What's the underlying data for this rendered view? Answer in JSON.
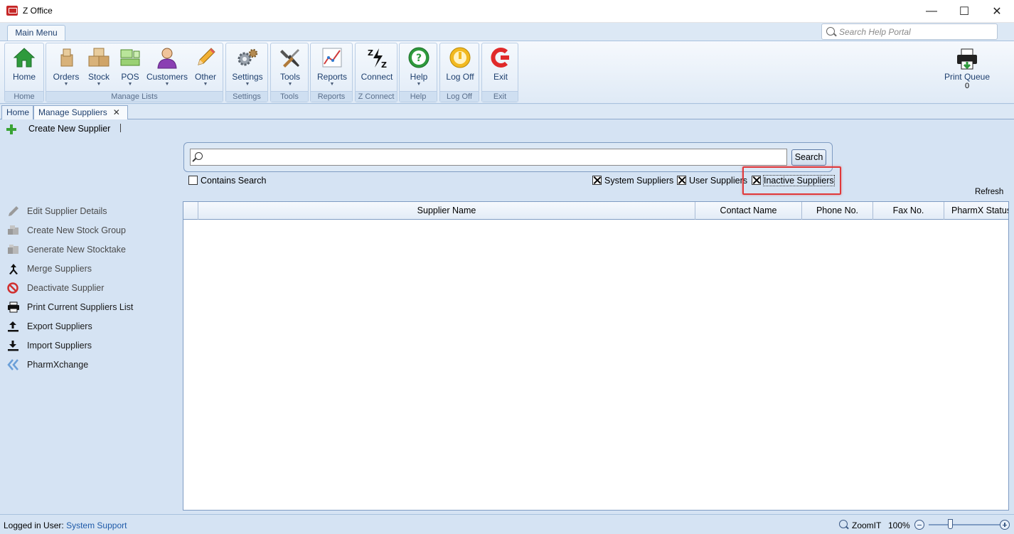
{
  "window": {
    "title": "Z Office",
    "controls": {
      "minimize": "—",
      "maximize": "☐",
      "close": "✕"
    }
  },
  "ribbon": {
    "tab": "Main Menu",
    "help_search_placeholder": "Search Help Portal",
    "groups": [
      {
        "label": "Home",
        "buttons": [
          {
            "label": "Home",
            "icon": "home-icon",
            "dropdown": false
          }
        ]
      },
      {
        "label": "Manage Lists",
        "buttons": [
          {
            "label": "Orders",
            "icon": "orders-icon",
            "dropdown": true
          },
          {
            "label": "Stock",
            "icon": "stock-icon",
            "dropdown": true
          },
          {
            "label": "POS",
            "icon": "pos-icon",
            "dropdown": true
          },
          {
            "label": "Customers",
            "icon": "customers-icon",
            "dropdown": true
          },
          {
            "label": "Other",
            "icon": "pencil-icon",
            "dropdown": true
          }
        ]
      },
      {
        "label": "Settings",
        "buttons": [
          {
            "label": "Settings",
            "icon": "gears-icon",
            "dropdown": true
          }
        ]
      },
      {
        "label": "Tools",
        "buttons": [
          {
            "label": "Tools",
            "icon": "tools-icon",
            "dropdown": true
          }
        ]
      },
      {
        "label": "Reports",
        "buttons": [
          {
            "label": "Reports",
            "icon": "chart-icon",
            "dropdown": true
          }
        ]
      },
      {
        "label": "Z Connect",
        "buttons": [
          {
            "label": "Connect",
            "icon": "connect-icon",
            "dropdown": false
          }
        ]
      },
      {
        "label": "Help",
        "buttons": [
          {
            "label": "Help",
            "icon": "help-icon",
            "dropdown": true
          }
        ]
      },
      {
        "label": "Log Off",
        "buttons": [
          {
            "label": "Log Off",
            "icon": "logoff-icon",
            "dropdown": false
          }
        ]
      },
      {
        "label": "Exit",
        "buttons": [
          {
            "label": "Exit",
            "icon": "exit-icon",
            "dropdown": false
          }
        ]
      }
    ],
    "print_queue": {
      "label": "Print Queue",
      "count": "0"
    }
  },
  "doc_tabs": [
    {
      "label": "Home",
      "active": false,
      "closable": false
    },
    {
      "label": "Manage Suppliers",
      "active": true,
      "closable": true,
      "close_glyph": "✕"
    }
  ],
  "toolbar": {
    "create_label": "Create New Supplier"
  },
  "search": {
    "value": "",
    "button_label": "Search",
    "contains_search": {
      "label": "Contains Search",
      "checked": false
    },
    "filters": [
      {
        "label": "System Suppliers",
        "checked": true
      },
      {
        "label": "User Suppliers",
        "checked": true
      },
      {
        "label": "Inactive Suppliers",
        "checked": true,
        "highlighted": true
      }
    ],
    "refresh_label": "Refresh"
  },
  "actions": [
    {
      "label": "Edit Supplier Details",
      "icon": "pencil-icon",
      "enabled": false
    },
    {
      "label": "Create New Stock Group",
      "icon": "stock-group-icon",
      "enabled": false
    },
    {
      "label": "Generate New Stocktake",
      "icon": "stocktake-icon",
      "enabled": false
    },
    {
      "label": "Merge Suppliers",
      "icon": "merge-icon",
      "enabled": false
    },
    {
      "label": "Deactivate Supplier",
      "icon": "prohibited-icon",
      "enabled": false
    },
    {
      "label": "Print Current Suppliers List",
      "icon": "printer-icon",
      "enabled": true
    },
    {
      "label": "Export Suppliers",
      "icon": "export-icon",
      "enabled": true
    },
    {
      "label": "Import Suppliers",
      "icon": "import-icon",
      "enabled": true
    },
    {
      "label": "PharmXchange",
      "icon": "double-chevron-left-icon",
      "enabled": true
    }
  ],
  "grid": {
    "columns": [
      "",
      "Supplier Name",
      "Contact Name",
      "Phone No.",
      "Fax No.",
      "PharmX Status"
    ],
    "rows": []
  },
  "status": {
    "logged_in_label": "Logged in User:",
    "user": "System Support",
    "zoom_label": "ZoomIT",
    "zoom_value": "100%"
  },
  "colors": {
    "accent": "#1e3f6e",
    "highlight": "#e0383a",
    "link": "#1e5aa8"
  }
}
